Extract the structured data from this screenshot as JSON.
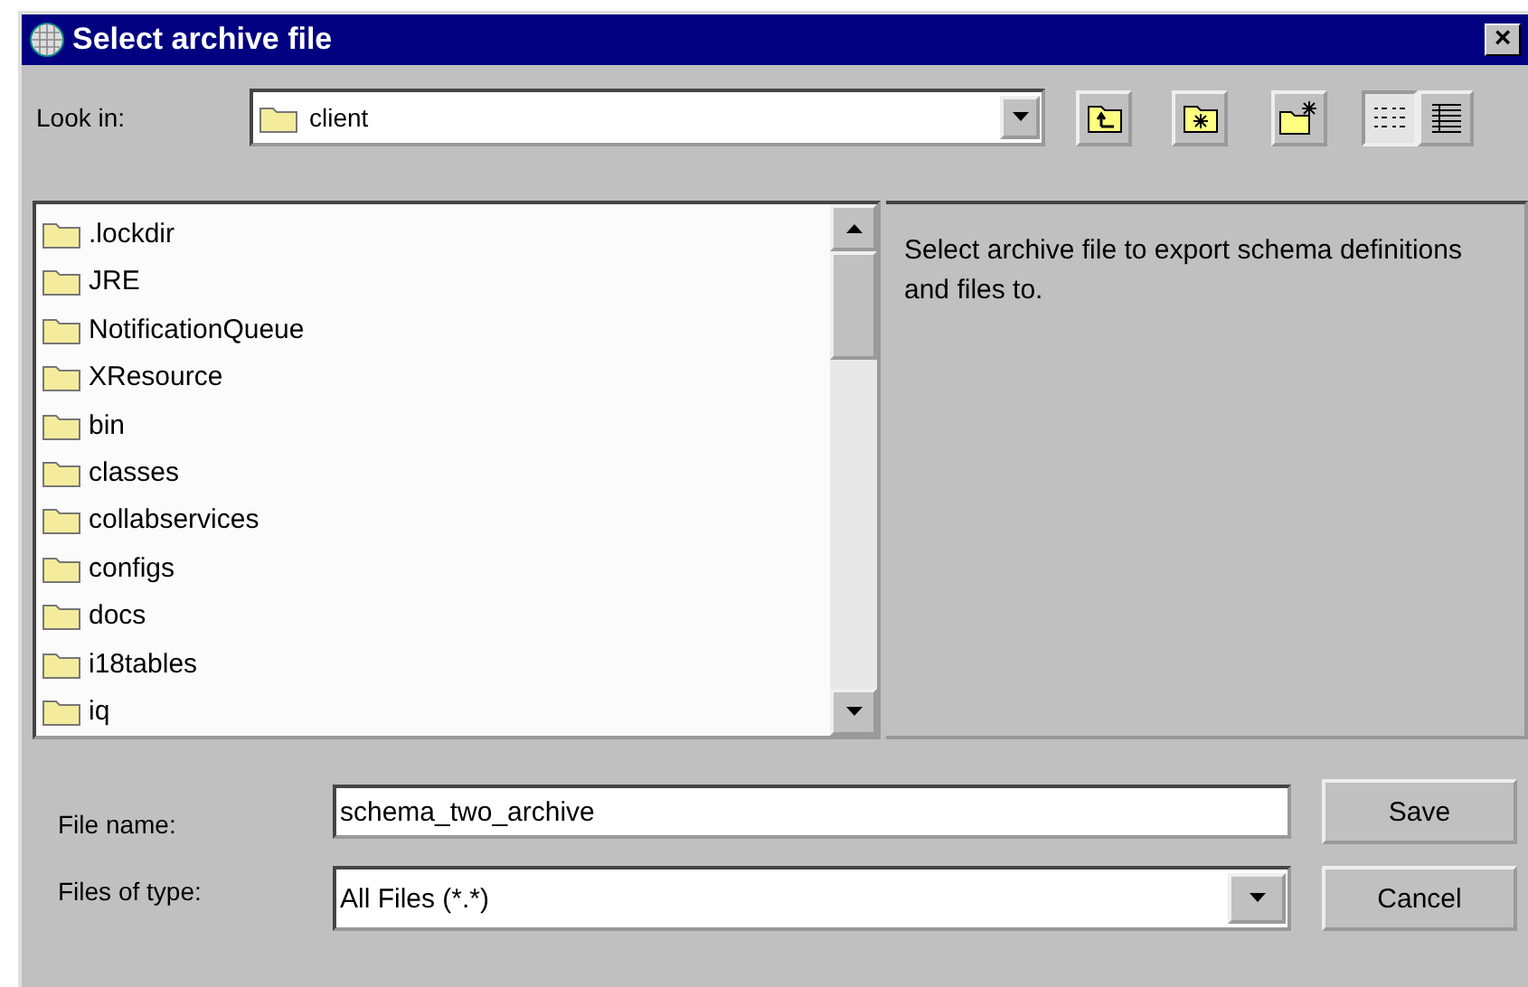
{
  "window": {
    "title": "Select archive file",
    "close": "×"
  },
  "look_in": {
    "label": "Look in:",
    "value": "client"
  },
  "toolbar": [
    {
      "kind": "up",
      "selected": false
    },
    {
      "kind": "home",
      "selected": false
    },
    {
      "kind": "new",
      "selected": false
    },
    {
      "kind": "list",
      "selected": true
    },
    {
      "kind": "details",
      "selected": false
    }
  ],
  "files": [
    {
      "name": ".lockdir"
    },
    {
      "name": "JRE"
    },
    {
      "name": "NotificationQueue"
    },
    {
      "name": "XResource"
    },
    {
      "name": "bin"
    },
    {
      "name": "classes"
    },
    {
      "name": "collabservices"
    },
    {
      "name": "configs"
    },
    {
      "name": "docs"
    },
    {
      "name": "i18tables"
    },
    {
      "name": "iq"
    }
  ],
  "description": "Select archive file to export schema definitions and files to.",
  "file_name": {
    "label": "File name:",
    "value": "schema_two_archive"
  },
  "file_type": {
    "label": "Files of type:",
    "value": "All Files (*.*)"
  },
  "buttons": [
    {
      "label": "Save"
    },
    {
      "label": "Cancel"
    }
  ]
}
